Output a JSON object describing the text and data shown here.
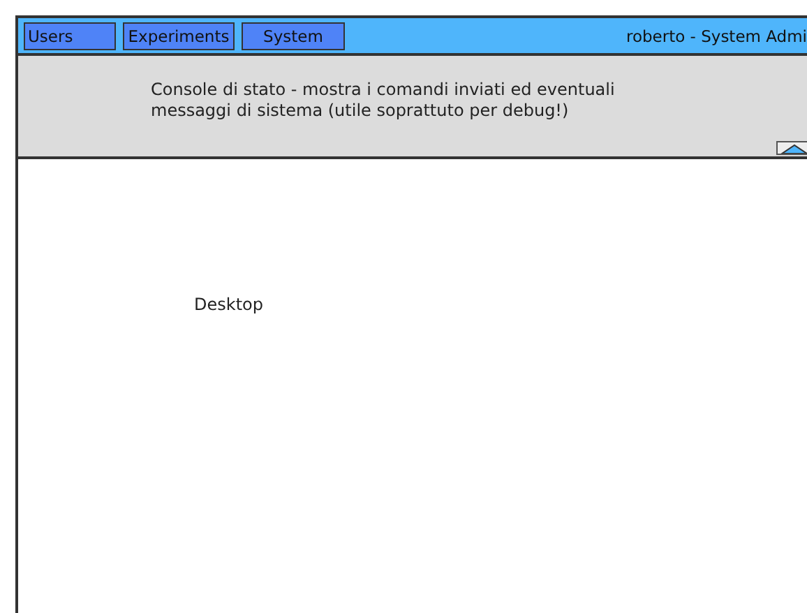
{
  "menu_bar": {
    "buttons": [
      {
        "label": "Users"
      },
      {
        "label": "Experiments"
      },
      {
        "label": "System"
      }
    ],
    "user": "roberto - System Admi"
  },
  "console": {
    "text": "Console di stato - mostra i comandi inviati ed eventuali messaggi di sistema (utile soprattuto per debug!)"
  },
  "desktop": {
    "label": "Desktop"
  }
}
